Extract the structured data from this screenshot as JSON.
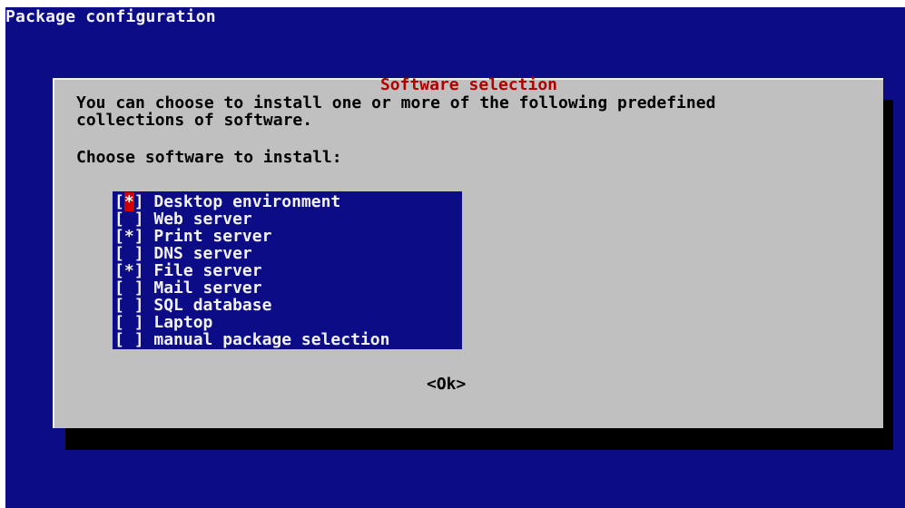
{
  "window": {
    "title": "Package configuration"
  },
  "dialog": {
    "title": "Software selection",
    "description_line1": "You can choose to install one or more of the following predefined",
    "description_line2": "collections of software.",
    "prompt": "Choose software to install:",
    "ok_label": "<Ok>"
  },
  "software": [
    {
      "label": "Desktop environment",
      "checked": true,
      "focused": true
    },
    {
      "label": "Web server",
      "checked": false,
      "focused": false
    },
    {
      "label": "Print server",
      "checked": true,
      "focused": false
    },
    {
      "label": "DNS server",
      "checked": false,
      "focused": false
    },
    {
      "label": "File server",
      "checked": true,
      "focused": false
    },
    {
      "label": "Mail server",
      "checked": false,
      "focused": false
    },
    {
      "label": "SQL database",
      "checked": false,
      "focused": false
    },
    {
      "label": "Laptop",
      "checked": false,
      "focused": false
    },
    {
      "label": "manual package selection",
      "checked": false,
      "focused": false
    }
  ],
  "colors": {
    "background": "#0c0c86",
    "dialog": "#c0c0c0",
    "title_accent": "#b00000",
    "focus_mark": "#d00000"
  }
}
